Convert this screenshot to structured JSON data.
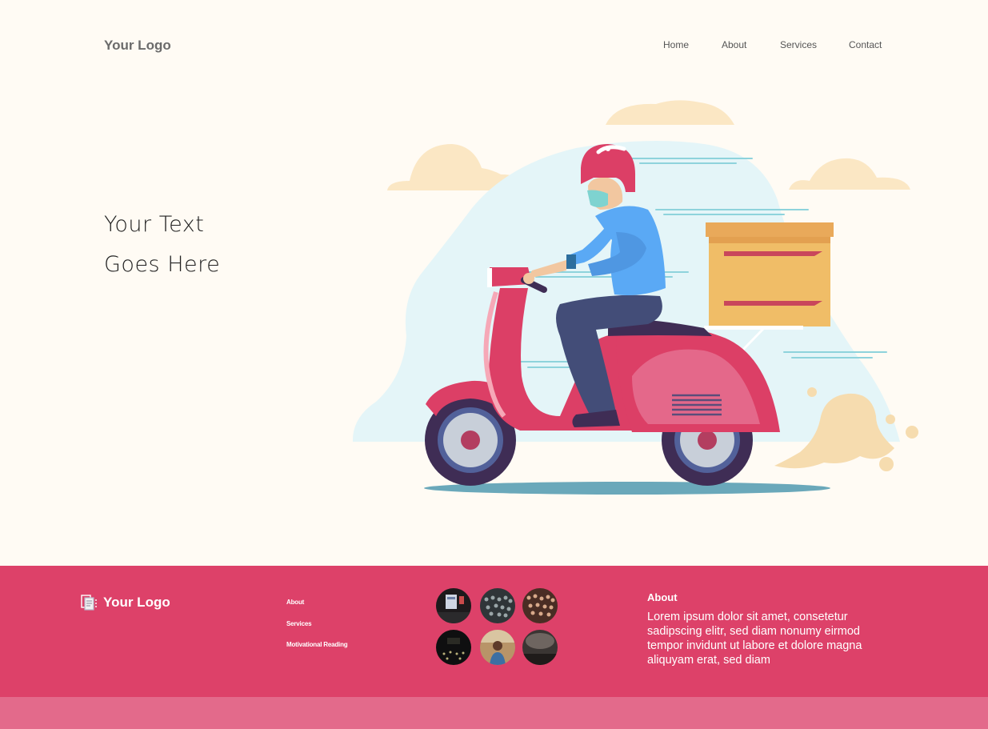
{
  "header": {
    "logo": "Your Logo",
    "nav": [
      "Home",
      "About",
      "Services",
      "Contact"
    ]
  },
  "hero": {
    "line1": "Your Text",
    "line2": "Goes Here",
    "illustration": "delivery-scooter-illustration"
  },
  "footer": {
    "logo": "Your Logo",
    "logo_icon": "document-icon",
    "links": [
      "About",
      "Services",
      "Motivational Reading"
    ],
    "gallery_count": 6,
    "about_title": "About",
    "about_text": "Lorem ipsum dolor sit amet, consetetur sadipscing elitr, sed diam nonumy eirmod tempor invidunt ut labore et dolore magna aliquyam erat, sed diam"
  },
  "colors": {
    "background": "#fffbf4",
    "footer": "#dd4169",
    "footer_bottom": "#e36a8b",
    "scooter": "#dc3f66",
    "box": "#f0bd67",
    "shirt": "#5aa9f5"
  }
}
